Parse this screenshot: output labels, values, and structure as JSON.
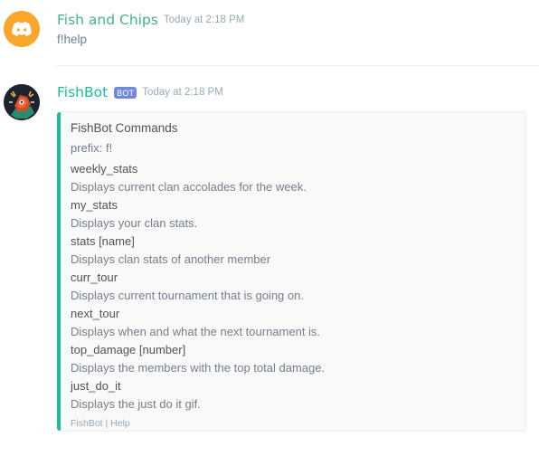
{
  "colors": {
    "user_name": "#43b581",
    "bot_name": "#1abc9c",
    "embed_accent": "#1abc9c",
    "bot_tag": "#7289da",
    "discord_avatar_bg": "#f9a62b"
  },
  "messages": [
    {
      "author": "Fish and Chips",
      "timestamp": "Today at 2:18 PM",
      "text": "f!help",
      "avatar_icon": "discord-logo-icon"
    },
    {
      "author": "FishBot",
      "bot_tag": "BOT",
      "timestamp": "Today at 2:18 PM",
      "avatar_icon": "fishbot-avatar-icon",
      "embed": {
        "title": "FishBot Commands",
        "description": "prefix: f!",
        "fields": [
          {
            "name": "weekly_stats",
            "value": "Displays current clan accolades for the week."
          },
          {
            "name": "my_stats",
            "value": "Displays your clan stats."
          },
          {
            "name": "stats [name]",
            "value": "Displays clan stats of another member"
          },
          {
            "name": "curr_tour",
            "value": "Displays current tournament that is going on."
          },
          {
            "name": "next_tour",
            "value": "Displays when and what the next tournament is."
          },
          {
            "name": "top_damage [number]",
            "value": "Displays the members with the top total damage."
          },
          {
            "name": "just_do_it",
            "value": "Displays the just do it gif."
          }
        ],
        "footer": "FishBot | Help"
      }
    }
  ]
}
